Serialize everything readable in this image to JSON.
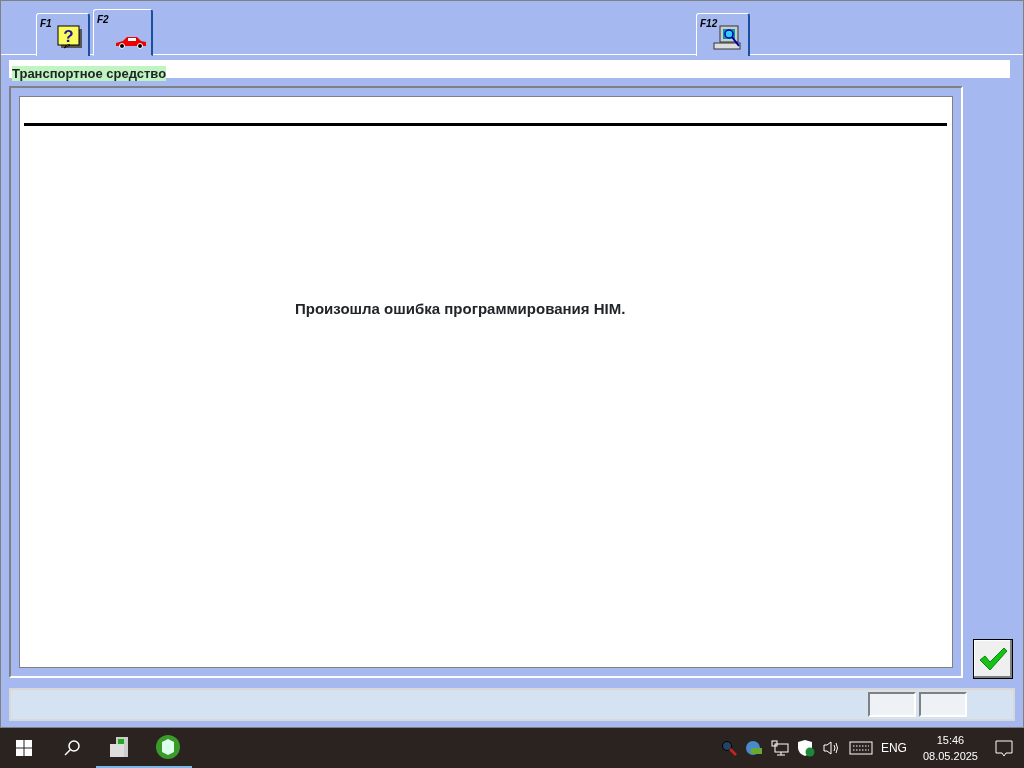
{
  "tabs": [
    {
      "key": "F1",
      "kind": "help",
      "symbol": "?",
      "selected": false
    },
    {
      "key": "F2",
      "kind": "car",
      "selected": true
    },
    {
      "key": "F12",
      "kind": "computer",
      "selected": false
    }
  ],
  "section_title": "Транспортное средство",
  "message": "Произошла ошибка программирования HIM.",
  "taskbar": {
    "language": "ENG",
    "time": "15:46",
    "date": "08.05.2025"
  }
}
